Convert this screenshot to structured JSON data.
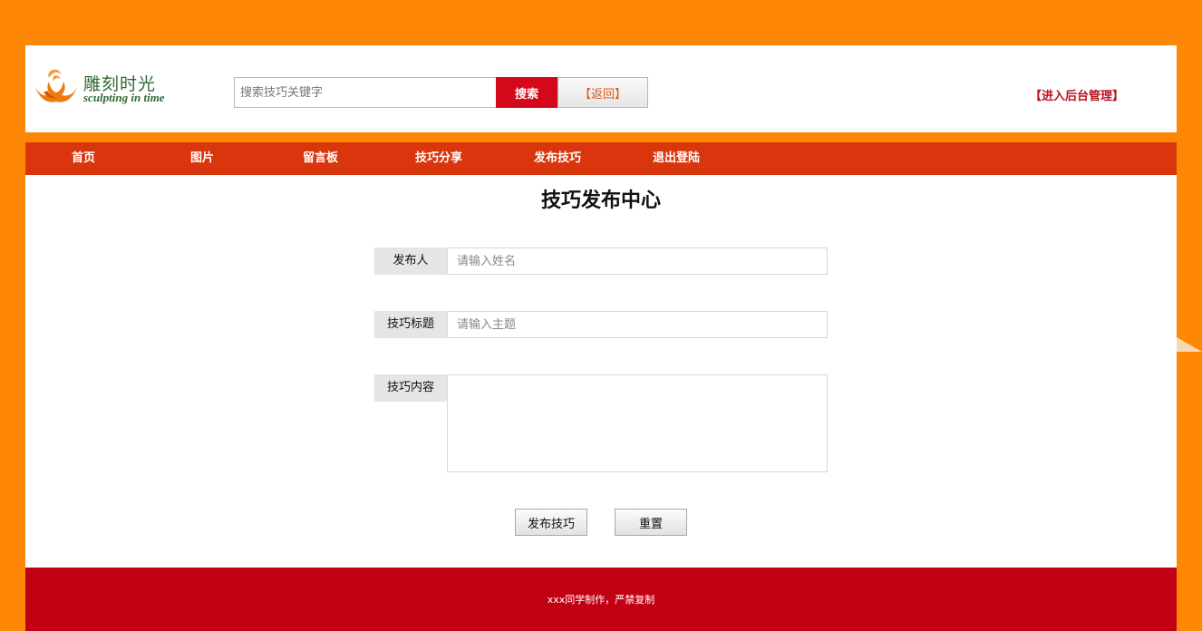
{
  "header": {
    "logo_cn": "雕刻时光",
    "logo_en": "sculpting in time",
    "search_placeholder": "搜索技巧关键字",
    "search_button": "搜索",
    "back_button": "【返回】",
    "admin_link": "【进入后台管理】"
  },
  "nav": {
    "items": [
      "首页",
      "图片",
      "留言板",
      "技巧分享",
      "发布技巧",
      "退出登陆"
    ]
  },
  "form": {
    "title": "技巧发布中心",
    "author_label": "发布人",
    "author_placeholder": "请输入姓名",
    "topic_label": "技巧标题",
    "topic_placeholder": "请输入主题",
    "content_label": "技巧内容",
    "content_value": "",
    "submit_button": "发布技巧",
    "reset_button": "重置"
  },
  "footer": {
    "text": "xxx同学制作，严禁复制"
  },
  "colors": {
    "page_bg": "#fe8806",
    "nav_bg": "#d9360d",
    "search_button_bg": "#d3091b",
    "footer_bg": "#c20014",
    "admin_link": "#b8131c"
  }
}
